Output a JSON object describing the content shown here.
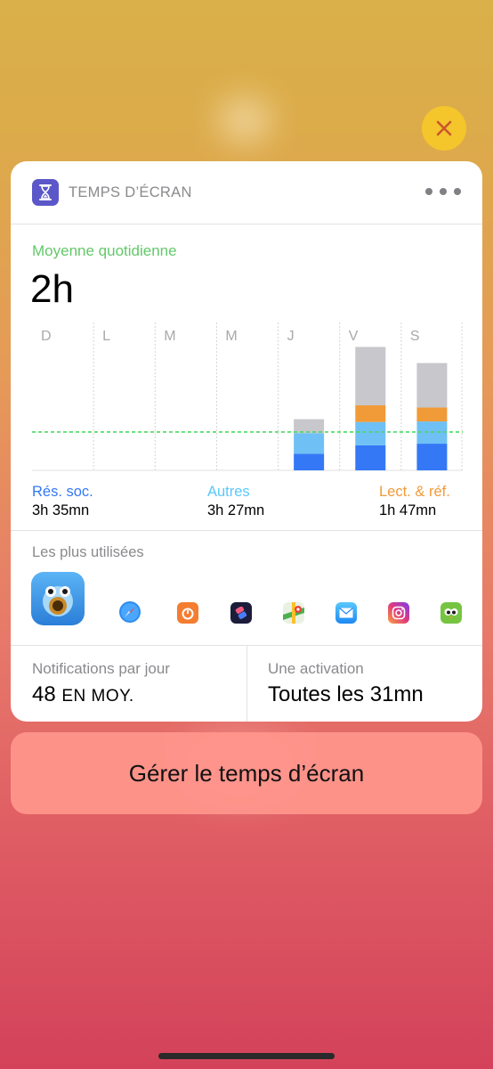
{
  "widget": {
    "title": "TEMPS D’ÉCRAN",
    "avg_label": "Moyenne quotidienne",
    "avg_value": "2h",
    "most_used_label": "Les plus utilisées"
  },
  "chart_data": {
    "type": "bar",
    "categories": [
      "D",
      "L",
      "M",
      "M",
      "J",
      "V",
      "S"
    ],
    "series": [
      {
        "name": "Rés. soc.",
        "color": "#3478f6",
        "values": [
          0,
          0,
          0,
          0,
          0.3,
          0.45,
          0.48
        ]
      },
      {
        "name": "Autres",
        "color": "#6fc0f4",
        "values": [
          0,
          0,
          0,
          0,
          0.37,
          0.42,
          0.4
        ]
      },
      {
        "name": "Lect. & réf.",
        "color": "#f19a38",
        "values": [
          0,
          0,
          0,
          0,
          0,
          0.3,
          0.25
        ]
      },
      {
        "name": "",
        "color": "#c7c7cc",
        "values": [
          0,
          0,
          0,
          0,
          0.25,
          1.05,
          0.8
        ]
      }
    ],
    "average": 0.69,
    "average_color": "#4cd964",
    "ylim": [
      0,
      2.5
    ],
    "grid": true
  },
  "legend": [
    {
      "label": "Rés. soc.",
      "value": "3h 35mn",
      "color": "#3478f6"
    },
    {
      "label": "Autres",
      "value": "3h 27mn",
      "color": "#5ac8fa"
    },
    {
      "label": "Lect. & réf.",
      "value": "1h 47mn",
      "color": "#f19a38"
    }
  ],
  "apps": [
    "tweetbot-icon",
    "safari-icon",
    "timer-icon",
    "shortcuts-icon",
    "google-maps-icon",
    "mail-icon",
    "instagram-icon",
    "duolingo-icon"
  ],
  "stats": {
    "notif_label": "Notifications par jour",
    "notif_value": "48",
    "notif_suffix": "EN MOY.",
    "activation_label": "Une activation",
    "activation_value": "Toutes les 31mn"
  },
  "manage_button": "Gérer le temps d’écran"
}
